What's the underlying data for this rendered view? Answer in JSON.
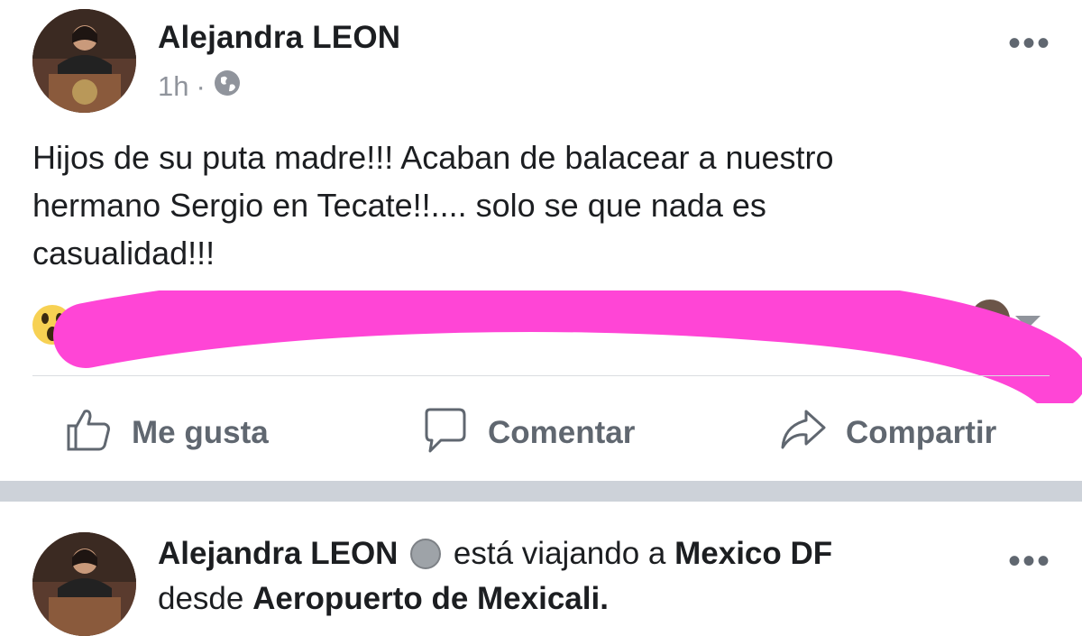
{
  "post1": {
    "author": "Alejandra LEON",
    "time": "1h",
    "separator_dot": "·",
    "privacy_icon": "globe-icon",
    "text_lines": [
      "Hijos de su puta madre!!! Acaban de balacear a nuestro",
      "hermano Sergio en Tecate!!.... solo se que nada es",
      "casualidad!!!"
    ],
    "reaction_icon": "wow-emoji-icon",
    "redaction_color": "#ff45d6",
    "actions": {
      "like": "Me gusta",
      "comment": "Comentar",
      "share": "Compartir"
    },
    "menu_icon": "more-icon"
  },
  "post2": {
    "author": "Alejandra LEON",
    "status_prefix": "está viajando a",
    "destination": "Mexico DF",
    "from_prefix": "desde",
    "origin": "Aeropuerto de Mexicali."
  },
  "colors": {
    "text": "#1c1e21",
    "muted": "#606770",
    "separator": "#cdd2d9"
  }
}
